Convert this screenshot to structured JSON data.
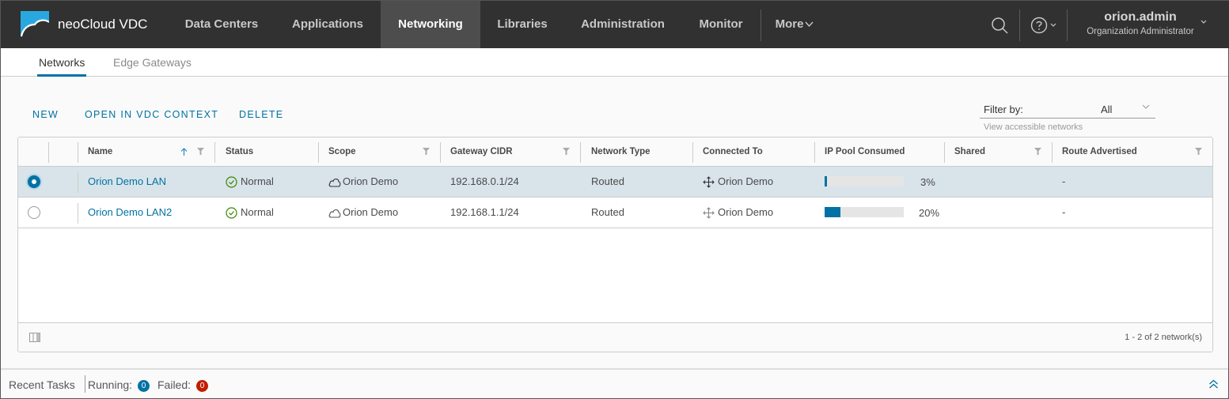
{
  "header": {
    "brand": "neoCloud VDC",
    "nav": [
      {
        "label": "Data Centers",
        "active": false
      },
      {
        "label": "Applications",
        "active": false
      },
      {
        "label": "Networking",
        "active": true
      },
      {
        "label": "Libraries",
        "active": false
      },
      {
        "label": "Administration",
        "active": false
      },
      {
        "label": "Monitor",
        "active": false
      }
    ],
    "more_label": "More",
    "user": {
      "name": "orion.admin",
      "role": "Organization Administrator"
    },
    "icons": [
      "search-icon",
      "help-icon",
      "chevron-down-icon"
    ]
  },
  "subnav": {
    "tabs": [
      {
        "label": "Networks",
        "active": true
      },
      {
        "label": "Edge Gateways",
        "active": false
      }
    ]
  },
  "toolbar": {
    "new_label": "NEW",
    "open_label": "OPEN IN VDC CONTEXT",
    "delete_label": "DELETE"
  },
  "filter": {
    "label": "Filter by:",
    "value": "All",
    "hint": "View accessible networks"
  },
  "grid": {
    "columns": [
      {
        "label": "Name",
        "sort": "ascending",
        "filter": true
      },
      {
        "label": "Status",
        "filter": false
      },
      {
        "label": "Scope",
        "filter": true
      },
      {
        "label": "Gateway CIDR",
        "filter": true
      },
      {
        "label": "Network Type",
        "filter": false
      },
      {
        "label": "Connected To",
        "filter": false
      },
      {
        "label": "IP Pool Consumed",
        "filter": false
      },
      {
        "label": "Shared",
        "filter": true
      },
      {
        "label": "Route Advertised",
        "filter": true
      }
    ],
    "rows": [
      {
        "selected": true,
        "name": "Orion Demo LAN",
        "status": "Normal",
        "scope": "Orion Demo",
        "gateway_cidr": "192.168.0.1/24",
        "network_type": "Routed",
        "connected_to": "Orion Demo",
        "ip_pool_consumed": 3,
        "ip_pool_label": "3%",
        "shared": "",
        "route_advertised": "-"
      },
      {
        "selected": false,
        "name": "Orion Demo LAN2",
        "status": "Normal",
        "scope": "Orion Demo",
        "gateway_cidr": "192.168.1.1/24",
        "network_type": "Routed",
        "connected_to": "Orion Demo",
        "ip_pool_consumed": 20,
        "ip_pool_label": "20%",
        "shared": "",
        "route_advertised": "-"
      }
    ],
    "pagination": "1 - 2 of 2 network(s)"
  },
  "tasks": {
    "label": "Recent Tasks",
    "running_label": "Running:",
    "running_count": "0",
    "failed_label": "Failed:",
    "failed_count": "0"
  },
  "colors": {
    "header_bg": "#313131",
    "accent": "#0072a3",
    "selected_row": "#d9e4ea",
    "success": "#3c8500",
    "failed_badge": "#c21d00"
  }
}
